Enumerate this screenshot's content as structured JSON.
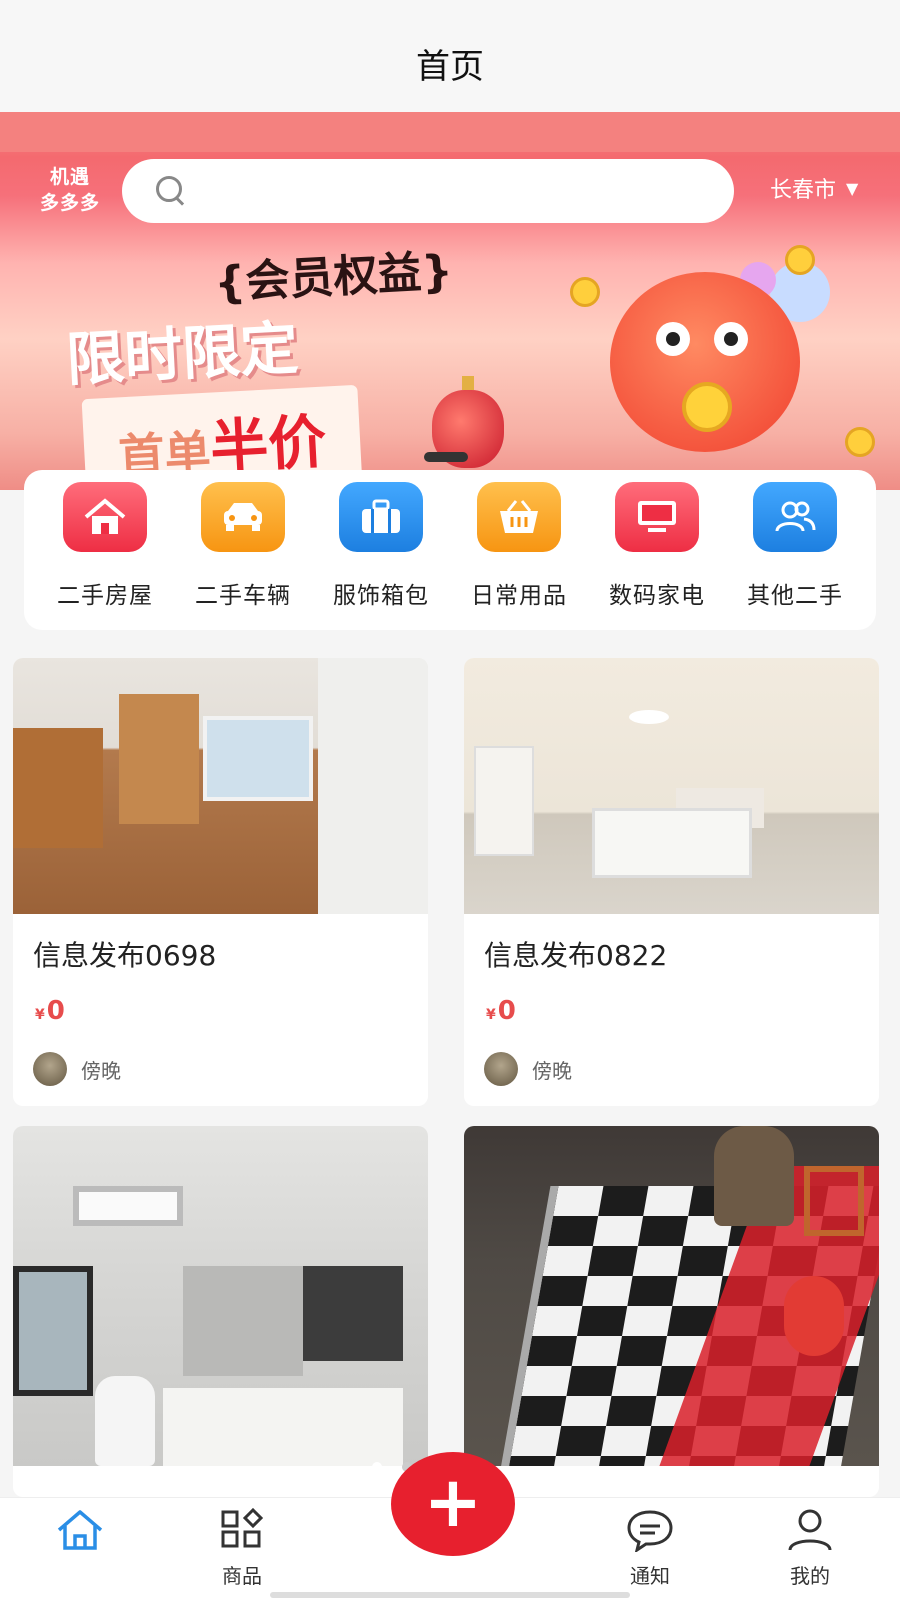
{
  "header": {
    "title": "首页"
  },
  "brand": {
    "line1": "机遇",
    "line2": "多多多"
  },
  "search": {
    "placeholder": "",
    "value": ""
  },
  "location": {
    "city": "长春市",
    "caret": "▼"
  },
  "banner": {
    "badge": "{会员权益}",
    "line1": "限时限定",
    "line2_a": "首单",
    "line2_b": "半价"
  },
  "categories": [
    {
      "label": "二手房屋",
      "icon": "house-icon",
      "color": "#f0354b"
    },
    {
      "label": "二手车辆",
      "icon": "car-icon",
      "color": "#f7a019"
    },
    {
      "label": "服饰箱包",
      "icon": "briefcase-icon",
      "color": "#2c8de8"
    },
    {
      "label": "日常用品",
      "icon": "basket-icon",
      "color": "#f7a019"
    },
    {
      "label": "数码家电",
      "icon": "monitor-icon",
      "color": "#f0354b"
    },
    {
      "label": "其他二手",
      "icon": "people-icon",
      "color": "#2c8de8"
    }
  ],
  "listings": [
    {
      "title": "信息发布0698",
      "currency": "¥",
      "price": "0",
      "user": "傍晚"
    },
    {
      "title": "信息发布0822",
      "currency": "¥",
      "price": "0",
      "user": "傍晚"
    }
  ],
  "tabs": [
    {
      "label": "",
      "icon": "home-icon"
    },
    {
      "label": "商品",
      "icon": "grid-icon"
    },
    {
      "label": "通知",
      "icon": "chat-icon"
    },
    {
      "label": "我的",
      "icon": "user-icon"
    }
  ],
  "fab": {
    "symbol": "+"
  },
  "colors": {
    "accent": "#e7202e",
    "price": "#e74c4c",
    "tab_active": "#2a8ee6"
  }
}
